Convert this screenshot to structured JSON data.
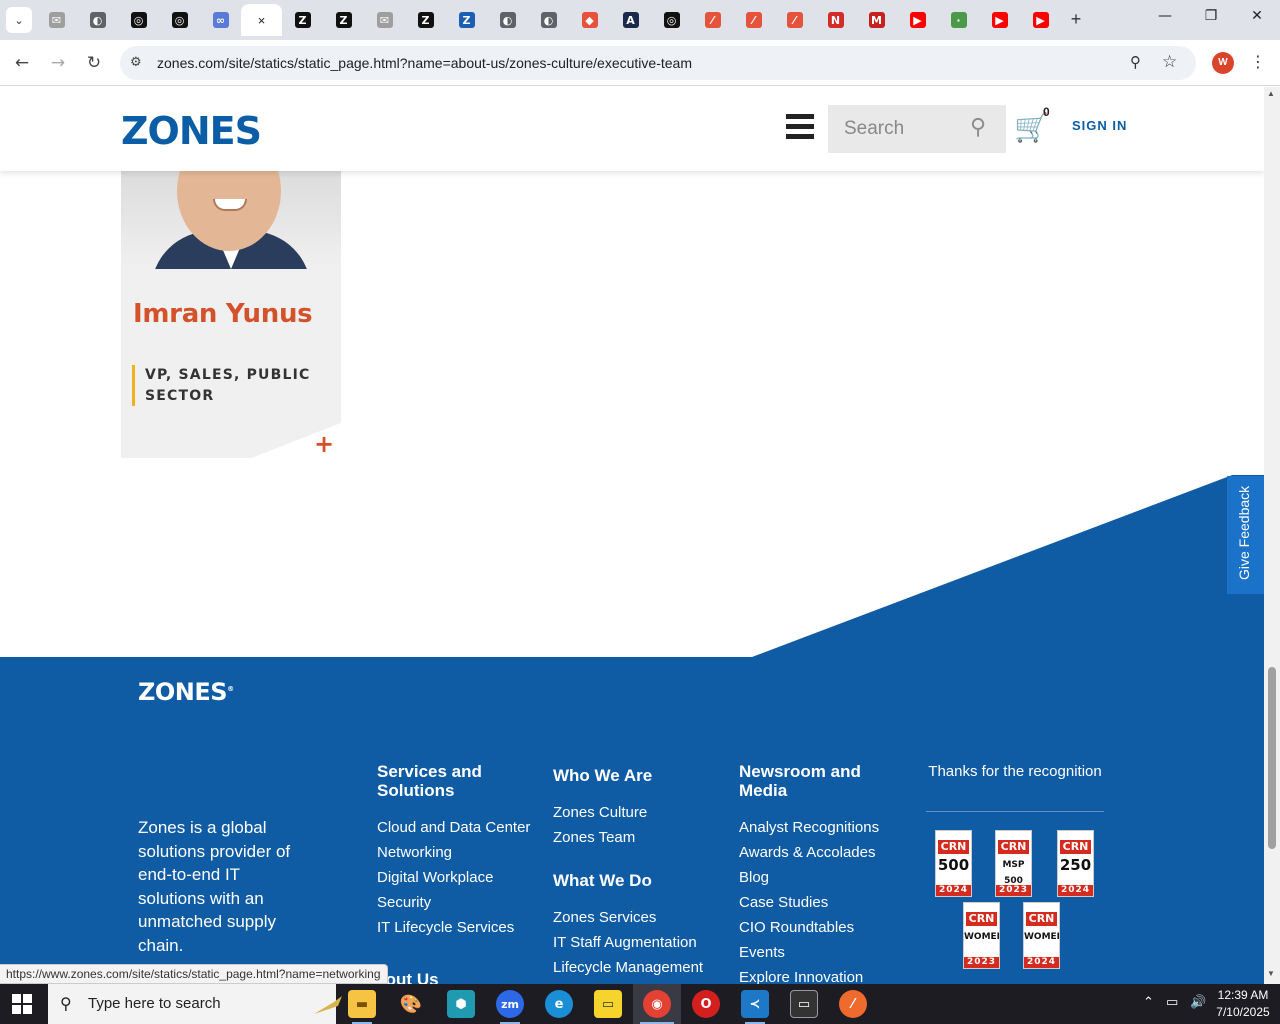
{
  "browser": {
    "active_tab_close": "×",
    "new_tab": "+",
    "url": "zones.com/site/statics/static_page.html?name=about-us/zones-culture/executive-team",
    "profile_initial": "W",
    "status_url": "https://www.zones.com/site/statics/static_page.html?name=networking",
    "tabs": [
      {
        "icon": "email-tab-icon",
        "glyph": "✉",
        "color": "#9e9e9e"
      },
      {
        "icon": "globe-tab-icon",
        "glyph": "◐",
        "color": "#5f6368"
      },
      {
        "icon": "openai-tab-icon",
        "glyph": "◎",
        "color": "#111111"
      },
      {
        "icon": "openai-tab-icon",
        "glyph": "◎",
        "color": "#111111"
      },
      {
        "icon": "copilot-tab-icon",
        "glyph": "∞",
        "color": "#5a7bd6"
      },
      {
        "icon": "active-tab-close-icon",
        "glyph": "",
        "color": "",
        "active": true
      },
      {
        "icon": "zones-tab-icon",
        "glyph": "Z",
        "color": "#111111"
      },
      {
        "icon": "zones-tab-icon",
        "glyph": "Z",
        "color": "#111111"
      },
      {
        "icon": "email-tab-icon",
        "glyph": "✉",
        "color": "#9e9e9e"
      },
      {
        "icon": "zones-tab-icon",
        "glyph": "Z",
        "color": "#111111"
      },
      {
        "icon": "zones-blue-tab-icon",
        "glyph": "Z",
        "color": "#1a5fb4"
      },
      {
        "icon": "globe-tab-icon",
        "glyph": "◐",
        "color": "#5f6368"
      },
      {
        "icon": "globe-tab-icon",
        "glyph": "◐",
        "color": "#5f6368"
      },
      {
        "icon": "ticket-tab-icon",
        "glyph": "◆",
        "color": "#e5533d"
      },
      {
        "icon": "linear-tab-icon",
        "glyph": "A",
        "color": "#1b2a4a"
      },
      {
        "icon": "openai-tab-icon",
        "glyph": "◎",
        "color": "#111111"
      },
      {
        "icon": "swipe-tab-icon",
        "glyph": "⁄",
        "color": "#e5533d"
      },
      {
        "icon": "swipe-tab-icon",
        "glyph": "⁄",
        "color": "#e5533d"
      },
      {
        "icon": "swipe-tab-icon",
        "glyph": "⁄",
        "color": "#e5533d"
      },
      {
        "icon": "notion-tab-icon",
        "glyph": "N",
        "color": "#d42a2a"
      },
      {
        "icon": "gmail-tab-icon",
        "glyph": "M",
        "color": "#c5221f"
      },
      {
        "icon": "youtube-tab-icon",
        "glyph": "▶",
        "color": "#ff0000"
      },
      {
        "icon": "dot-tab-icon",
        "glyph": "·",
        "color": "#4a9a4a"
      },
      {
        "icon": "youtube-tab-icon",
        "glyph": "▶",
        "color": "#ff0000"
      },
      {
        "icon": "youtube-tab-icon",
        "glyph": "▶",
        "color": "#ff0000"
      }
    ]
  },
  "header": {
    "logo": "ZONES",
    "search_placeholder": "Search",
    "cart_count": "0",
    "sign_in": "SIGN IN"
  },
  "executive": {
    "name": "Imran Yunus",
    "title": "VP, SALES, PUBLIC SECTOR",
    "expand": "+"
  },
  "feedback": "Give Feedback",
  "footer": {
    "logo": "ZONES",
    "logo_mark": "®",
    "about": "Zones is a global solutions provider of end-to-end IT solutions with an unmatched supply chain.",
    "services": {
      "heading": "Services and Solutions",
      "links": [
        "Cloud and Data Center",
        "Networking",
        "Digital Workplace",
        "Security",
        "IT Lifecycle Services"
      ],
      "next_heading": "About Us"
    },
    "who": {
      "heading": "Who We Are",
      "links": [
        "Zones Culture",
        "Zones Team"
      ],
      "what_heading": "What We Do",
      "what_links": [
        "Zones Services",
        "IT Staff Augmentation",
        "Lifecycle Management"
      ]
    },
    "news": {
      "heading": "Newsroom and Media",
      "links": [
        "Analyst Recognitions",
        "Awards & Accolades",
        "Blog",
        "Case Studies",
        "CIO Roundtables",
        "Events",
        "Explore Innovation"
      ]
    },
    "recognition": {
      "title": "Thanks for the recognition",
      "badges": [
        {
          "brand": "CRN",
          "number": "500",
          "year": "2024"
        },
        {
          "brand": "CRN",
          "number": "MSP 500",
          "year": "2023"
        },
        {
          "brand": "CRN",
          "number": "250",
          "year": "2024"
        },
        {
          "brand": "CRN",
          "number": "WOMEN",
          "year": "2023"
        },
        {
          "brand": "CRN",
          "number": "WOMEN",
          "year": "2024"
        }
      ]
    }
  },
  "taskbar": {
    "search_text": "Type here to search",
    "time": "12:39 AM",
    "date": "7/10/2025"
  },
  "colors": {
    "brand_blue": "#0b5ea6",
    "footer_blue": "#0f5ba4",
    "accent_orange": "#d4522a",
    "accent_yellow": "#f2b01e"
  }
}
